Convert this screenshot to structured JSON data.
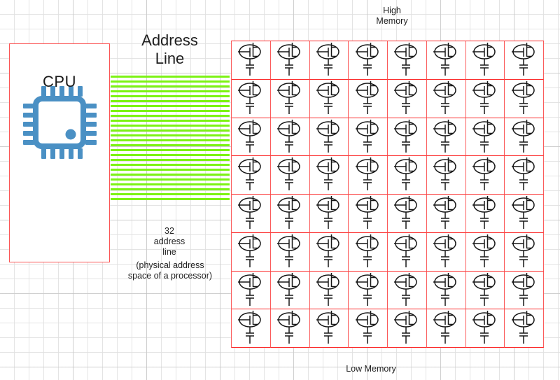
{
  "diagram": {
    "title": "CPU address line to physical memory diagram",
    "colors": {
      "cell_border": "#fb2b2b",
      "cpu_box_border": "#fb5555",
      "address_line": "#7cf314",
      "cpu_icon": "#4a90c4",
      "text": "#1f1f1f",
      "grid_background": "#ffffff"
    }
  },
  "cpu": {
    "box_label": "CPU",
    "icon": "cpu-chip-icon"
  },
  "address_line": {
    "title_line1": "Address",
    "title_line2": "Line",
    "count_line1": "32",
    "count_line2": "address",
    "count_line3": "line",
    "note_line1": "(physical address",
    "note_line2": "space of a processor)",
    "stripe_count": 26,
    "icon": "address-bus-stripes"
  },
  "memory": {
    "high_label_line1": "High",
    "high_label_line2": "Memory",
    "low_label": "Low Memory",
    "rows": 8,
    "columns": 8,
    "cell_count": 64,
    "cell_icon": "dram-cell-transistor-capacitor-icon"
  }
}
